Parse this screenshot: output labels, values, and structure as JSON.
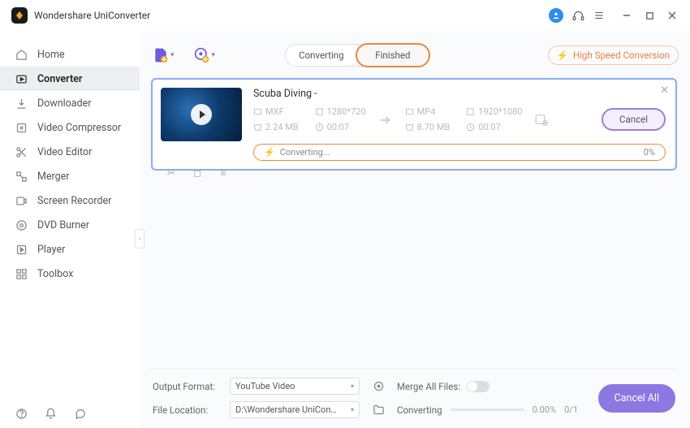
{
  "app": {
    "title": "Wondershare UniConverter"
  },
  "sidebar": {
    "items": [
      {
        "label": "Home"
      },
      {
        "label": "Converter"
      },
      {
        "label": "Downloader"
      },
      {
        "label": "Video Compressor"
      },
      {
        "label": "Video Editor"
      },
      {
        "label": "Merger"
      },
      {
        "label": "Screen Recorder"
      },
      {
        "label": "DVD Burner"
      },
      {
        "label": "Player"
      },
      {
        "label": "Toolbox"
      }
    ]
  },
  "tabs": {
    "converting": "Converting",
    "finished": "Finished"
  },
  "toolbar": {
    "high_speed": "High Speed Conversion"
  },
  "task": {
    "title": "Scuba Diving -",
    "source": {
      "format": "MXF",
      "resolution": "1280*720",
      "size": "2.24 MB",
      "duration": "00:07"
    },
    "target": {
      "format": "MP4",
      "resolution": "1920*1080",
      "size": "8.70 MB",
      "duration": "00:07"
    },
    "status": "Converting...",
    "progress": "0%",
    "cancel": "Cancel"
  },
  "bottom": {
    "output_format_label": "Output Format:",
    "output_format_value": "YouTube Video",
    "file_location_label": "File Location:",
    "file_location_value": "D:\\Wondershare UniConverter",
    "merge_label": "Merge All Files:",
    "converting_label": "Converting",
    "converting_pct": "0.00%",
    "converting_count": "0/1",
    "cancel_all": "Cancel All"
  }
}
